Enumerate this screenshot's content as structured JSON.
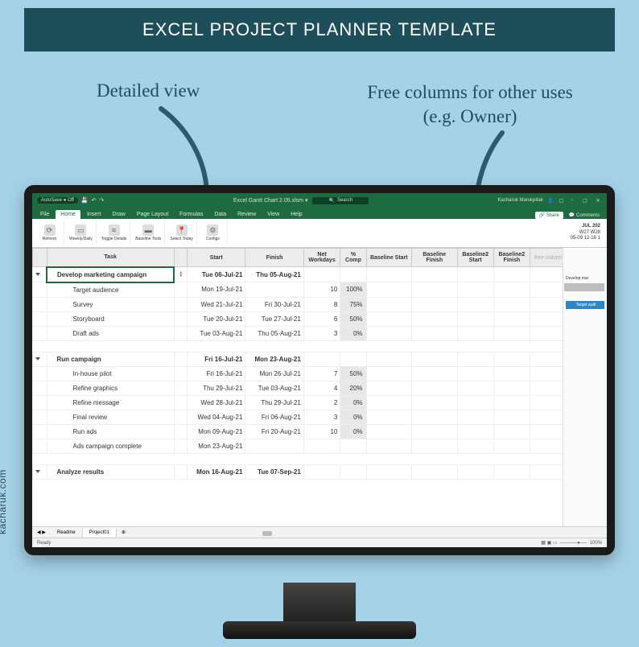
{
  "page_title": "EXCEL PROJECT PLANNER TEMPLATE",
  "annotations": {
    "left": "Detailed view",
    "right": "Free columns for other uses (e.g. Owner)"
  },
  "watermark": "kacharuk.com",
  "excel": {
    "autosave_label": "AutoSave ● Off",
    "filename": "Excel Gantt Chart 2.05.xlsm ▾",
    "search_placeholder": "Search",
    "username": "Kacharuk Marukpitak",
    "share_label": "Share",
    "comments_label": "Comments",
    "titlebar_icons": {
      "minimize": "−",
      "maximize": "▢",
      "close": "✕"
    },
    "tabs": {
      "file": "File",
      "home": "Home",
      "insert": "Insert",
      "draw": "Draw",
      "page_layout": "Page Layout",
      "formulas": "Formulas",
      "data": "Data",
      "review": "Review",
      "view": "View",
      "help": "Help"
    },
    "ribbon_buttons": {
      "refresh": "Refresh",
      "weekly": "Weekly/Daily",
      "toggle": "Toggle Details",
      "baseline": "Baseline Tools",
      "today": "Select Today",
      "config": "Configs"
    },
    "ribbon_right": {
      "line1": "JUL 202",
      "line2": "W27  W28",
      "line3": "05-09  12-16  1"
    },
    "columns": {
      "task": "Task",
      "start": "Start",
      "finish": "Finish",
      "workdays": "Net Workdays",
      "pct": "% Comp",
      "baseline_start": "Baseline Start",
      "baseline_finish": "Baseline Finish",
      "baseline2_start": "Baseline2 Start",
      "baseline2_finish": "Baseline2 Finish",
      "free1": "free column",
      "free2": "free column"
    },
    "rows": [
      {
        "type": "group",
        "task": "Develop marketing campaign",
        "start": "Tue 06-Jul-21",
        "finish": "Thu 05-Aug-21",
        "wd": "",
        "pct": ""
      },
      {
        "type": "sub",
        "task": "Target audience",
        "start": "Mon 19-Jul-21",
        "finish": "",
        "wd": "10",
        "pct": "100%"
      },
      {
        "type": "sub",
        "task": "Survey",
        "start": "Wed 21-Jul-21",
        "finish": "Fri 30-Jul-21",
        "wd": "8",
        "pct": "75%"
      },
      {
        "type": "sub",
        "task": "Storyboard",
        "start": "Tue 20-Jul-21",
        "finish": "Tue 27-Jul-21",
        "wd": "6",
        "pct": "50%"
      },
      {
        "type": "sub",
        "task": "Draft ads",
        "start": "Tue 03-Aug-21",
        "finish": "Thu 05-Aug-21",
        "wd": "3",
        "pct": "0%"
      },
      {
        "type": "blank"
      },
      {
        "type": "group",
        "task": "Run campaign",
        "start": "Fri 16-Jul-21",
        "finish": "Mon 23-Aug-21",
        "wd": "",
        "pct": ""
      },
      {
        "type": "sub",
        "task": "In-house pilot",
        "start": "Fri 16-Jul-21",
        "finish": "Mon 26-Jul-21",
        "wd": "7",
        "pct": "50%"
      },
      {
        "type": "sub",
        "task": "Refine graphics",
        "start": "Thu 29-Jul-21",
        "finish": "Tue 03-Aug-21",
        "wd": "4",
        "pct": "20%"
      },
      {
        "type": "sub",
        "task": "Refine message",
        "start": "Wed 28-Jul-21",
        "finish": "Thu 29-Jul-21",
        "wd": "2",
        "pct": "0%"
      },
      {
        "type": "sub",
        "task": "Final review",
        "start": "Wed 04-Aug-21",
        "finish": "Fri 06-Aug-21",
        "wd": "3",
        "pct": "0%"
      },
      {
        "type": "sub",
        "task": "Run ads",
        "start": "Mon 09-Aug-21",
        "finish": "Fri 20-Aug-21",
        "wd": "10",
        "pct": "0%"
      },
      {
        "type": "sub",
        "task": "Ads campaign complete",
        "start": "Mon 23-Aug-21",
        "finish": "",
        "wd": "",
        "pct": ""
      },
      {
        "type": "blank"
      },
      {
        "type": "group",
        "task": "Analyze results",
        "start": "Mon 16-Aug-21",
        "finish": "Tue 07-Sep-21",
        "wd": "",
        "pct": ""
      }
    ],
    "gantt_labels": {
      "bar1": "Develop mar",
      "bar2": "Target audi"
    },
    "sheets": {
      "readme": "Readme",
      "project": "Project01"
    },
    "statusbar": {
      "ready": "Ready",
      "zoom": "100%"
    }
  }
}
